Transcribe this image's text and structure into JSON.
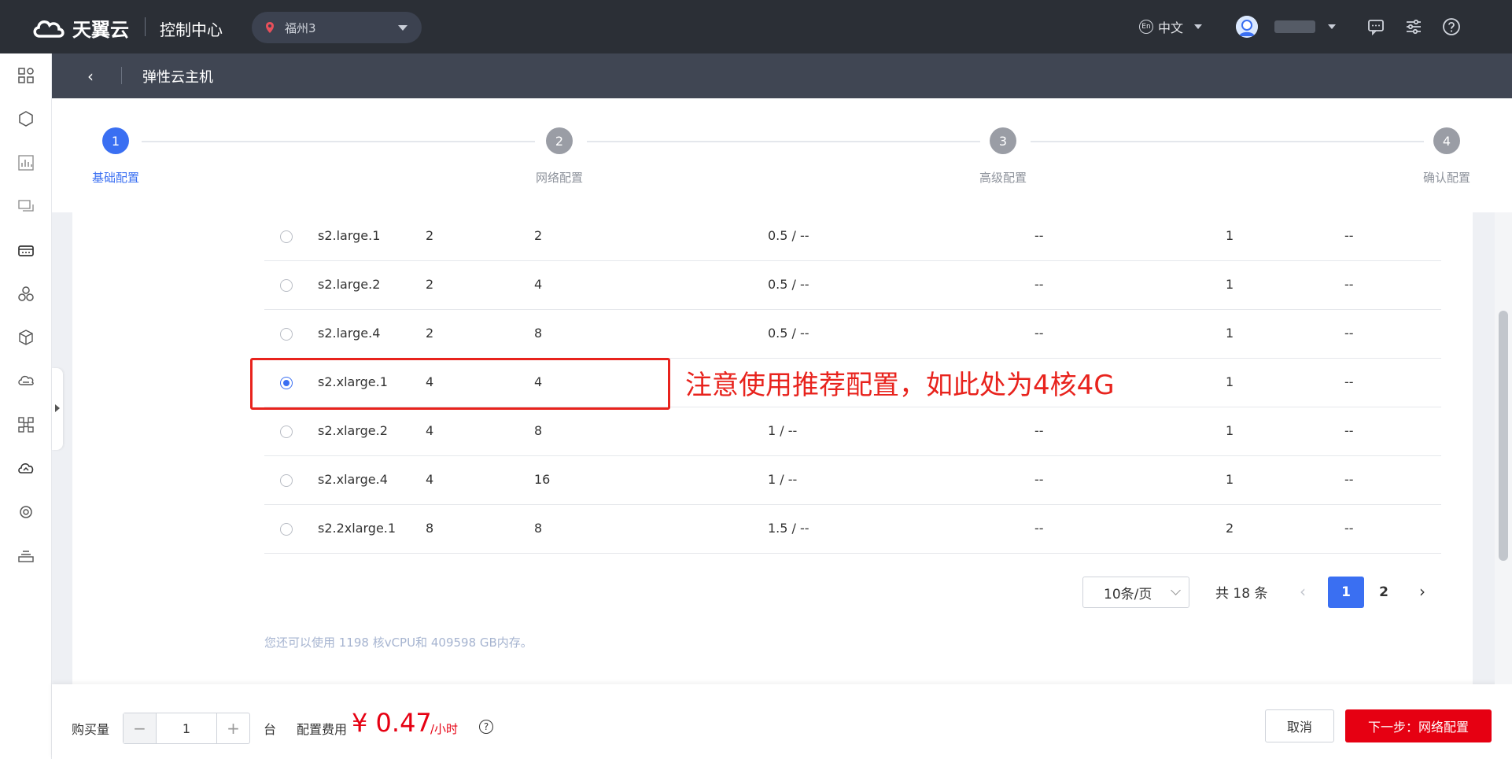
{
  "topbar": {
    "brand": "天翼云",
    "console": "控制中心",
    "region": "福州3",
    "lang_badge": "En",
    "lang": "中文"
  },
  "subbar": {
    "back": "‹",
    "title": "弹性云主机"
  },
  "steps": [
    {
      "num": "1",
      "label": "基础配置"
    },
    {
      "num": "2",
      "label": "网络配置"
    },
    {
      "num": "3",
      "label": "高级配置"
    },
    {
      "num": "4",
      "label": "确认配置"
    }
  ],
  "rows": [
    {
      "name": "s2.large.1",
      "vcpu": "2",
      "mem": "2",
      "bw": "0.5 / --",
      "c5": "--",
      "c6": "1",
      "c7": "--",
      "selected": false
    },
    {
      "name": "s2.large.2",
      "vcpu": "2",
      "mem": "4",
      "bw": "0.5 / --",
      "c5": "--",
      "c6": "1",
      "c7": "--",
      "selected": false
    },
    {
      "name": "s2.large.4",
      "vcpu": "2",
      "mem": "8",
      "bw": "0.5 / --",
      "c5": "--",
      "c6": "1",
      "c7": "--",
      "selected": false
    },
    {
      "name": "s2.xlarge.1",
      "vcpu": "4",
      "mem": "4",
      "bw": "",
      "c5": "",
      "c6": "1",
      "c7": "--",
      "selected": true
    },
    {
      "name": "s2.xlarge.2",
      "vcpu": "4",
      "mem": "8",
      "bw": "1 / --",
      "c5": "--",
      "c6": "1",
      "c7": "--",
      "selected": false
    },
    {
      "name": "s2.xlarge.4",
      "vcpu": "4",
      "mem": "16",
      "bw": "1 / --",
      "c5": "--",
      "c6": "1",
      "c7": "--",
      "selected": false
    },
    {
      "name": "s2.2xlarge.1",
      "vcpu": "8",
      "mem": "8",
      "bw": "1.5 / --",
      "c5": "--",
      "c6": "2",
      "c7": "--",
      "selected": false
    }
  ],
  "annotation": "注意使用推荐配置，如此处为4核4G",
  "pagination": {
    "page_size": "10条/页",
    "total": "共 18 条",
    "prev": "‹",
    "page1": "1",
    "page2": "2",
    "next": "›"
  },
  "quota_note": "您还可以使用 1198 核vCPU和 409598 GB内存。",
  "footer": {
    "qty_label": "购买量",
    "minus": "−",
    "qty": "1",
    "plus": "+",
    "unit_label": "台",
    "cost_label": "配置费用",
    "price": "¥ 0.47",
    "price_unit": "/小时",
    "help": "?",
    "cancel": "取消",
    "next": "下一步：网络配置"
  },
  "colors": {
    "accent": "#3a6ff2",
    "danger": "#e60012",
    "annotation": "#e8231d",
    "topbar": "#2b2f36"
  }
}
